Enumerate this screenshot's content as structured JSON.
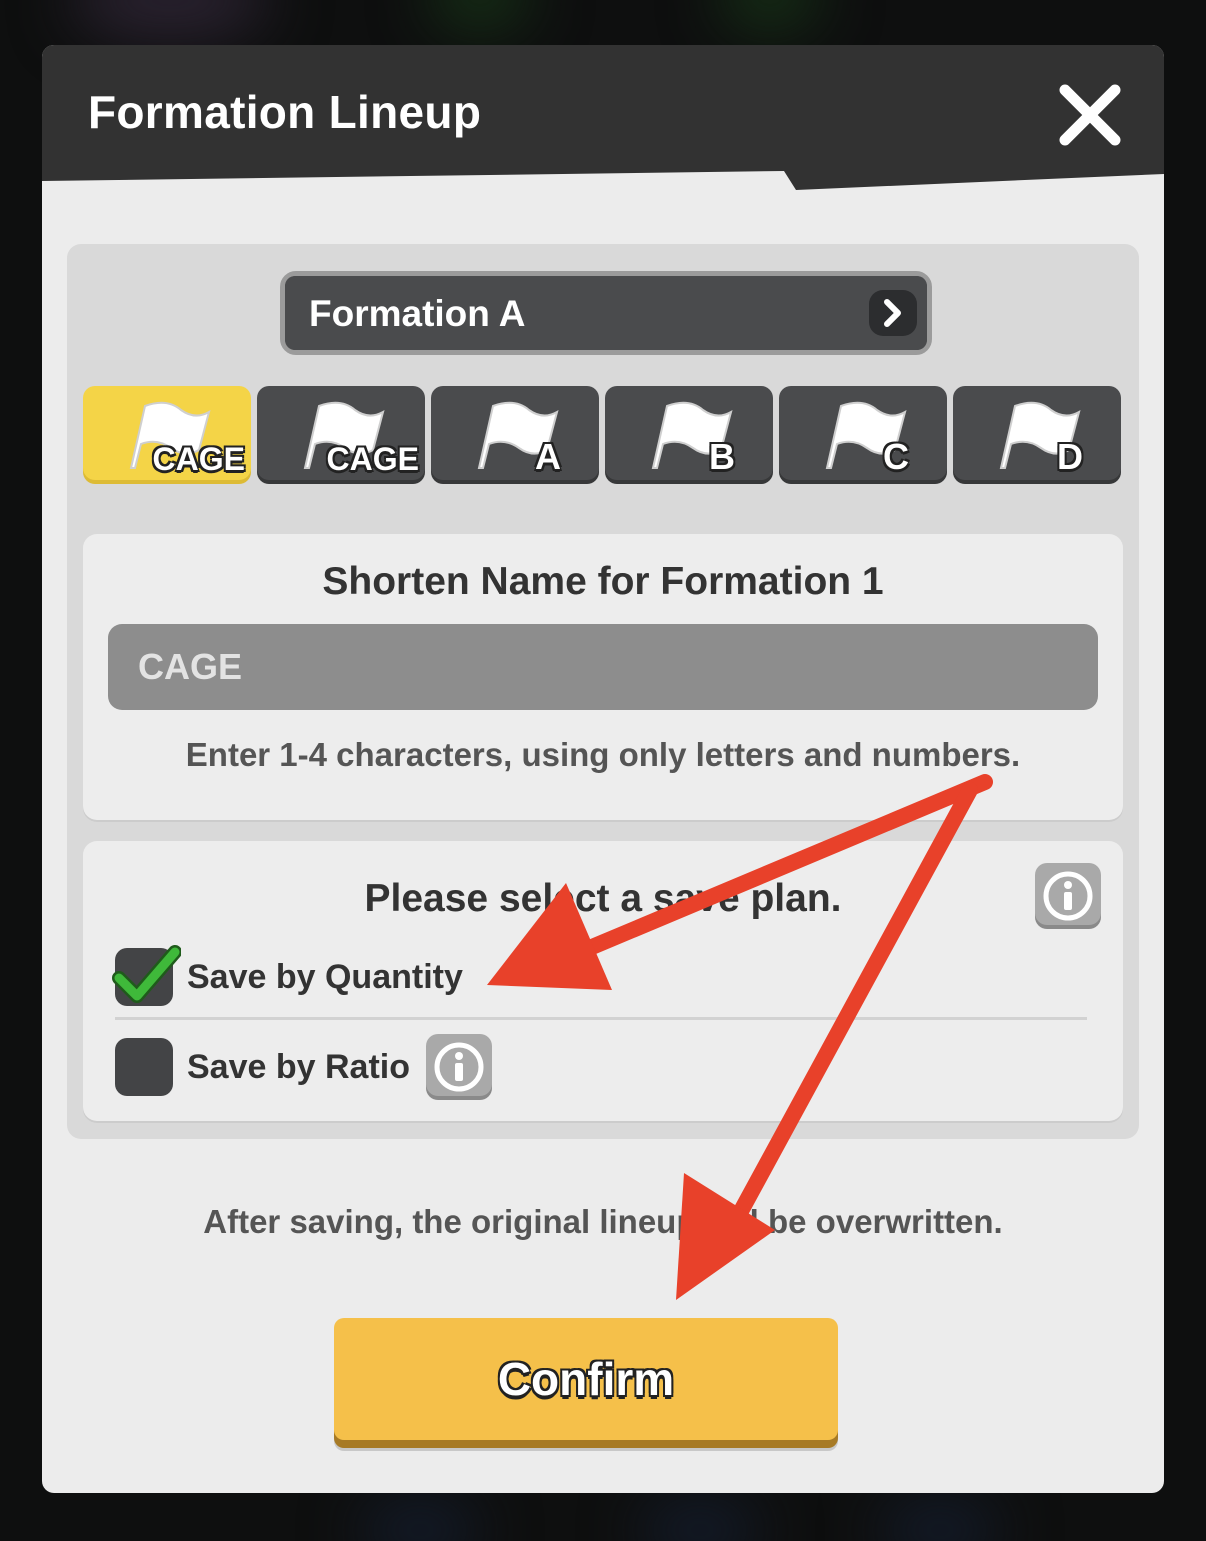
{
  "dialog": {
    "title": "Formation Lineup"
  },
  "formation_selector": {
    "label": "Formation A"
  },
  "tabs": [
    {
      "label": "CAGE",
      "active": true
    },
    {
      "label": "CAGE",
      "active": false
    },
    {
      "label": "A",
      "active": false
    },
    {
      "label": "B",
      "active": false
    },
    {
      "label": "C",
      "active": false
    },
    {
      "label": "D",
      "active": false
    }
  ],
  "name_section": {
    "title": "Shorten Name for Formation 1",
    "input_value": "CAGE",
    "hint": "Enter 1-4 characters, using only letters and numbers."
  },
  "save_plan": {
    "title": "Please select a save plan.",
    "options": [
      {
        "label": "Save by Quantity",
        "checked": true
      },
      {
        "label": "Save by Ratio",
        "checked": false
      }
    ]
  },
  "footer": {
    "note": "After saving, the original lineup will be overwritten.",
    "confirm_label": "Confirm"
  },
  "colors": {
    "accent_yellow": "#f4d447",
    "confirm_orange": "#f5c04a",
    "header_dark": "#323232",
    "annotation_red": "#e8412a",
    "check_green": "#3fb93a"
  }
}
